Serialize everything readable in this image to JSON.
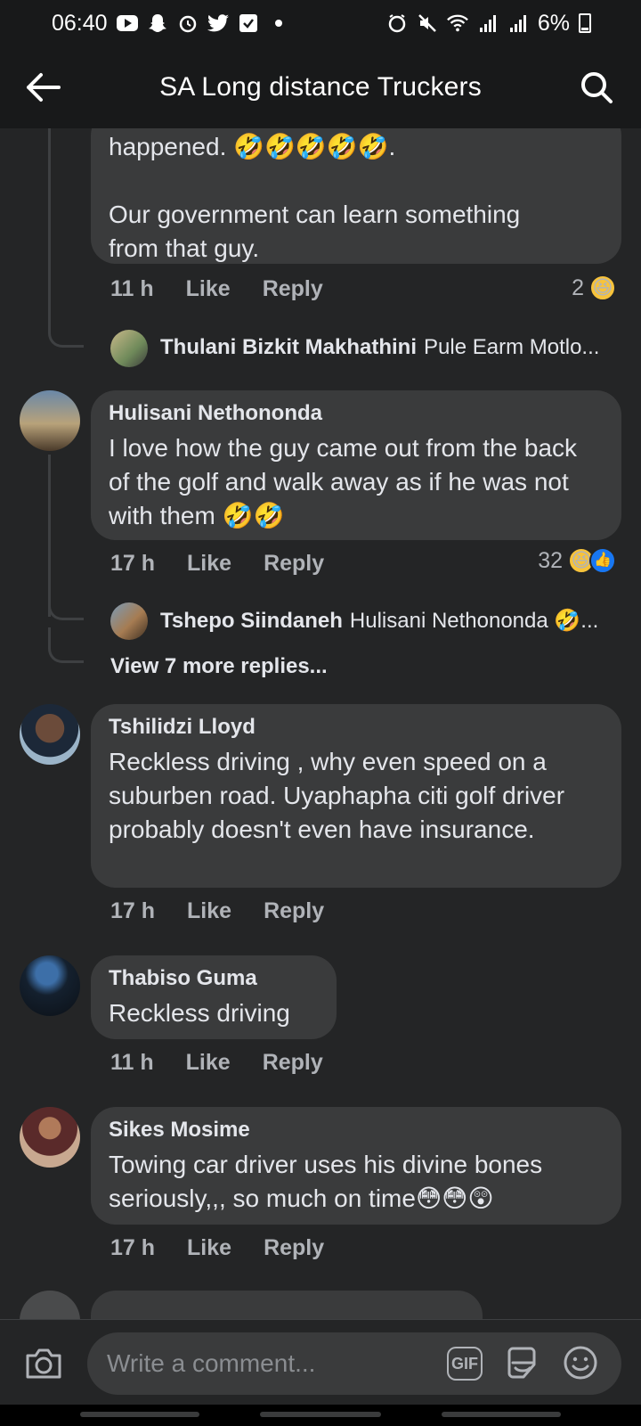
{
  "status_bar": {
    "time": "06:40",
    "battery": "6%",
    "left_icons": [
      "youtube-icon",
      "snapchat-icon",
      "alarm-app-icon",
      "twitter-icon",
      "download-icon"
    ],
    "right_icons": [
      "alarm-icon",
      "mute-icon",
      "wifi-icon",
      "signal-icon",
      "signal-icon-2",
      "battery-icon"
    ]
  },
  "header": {
    "title": "SA Long distance Truckers"
  },
  "comments": [
    {
      "text_line1": "happened. 🤣🤣🤣🤣🤣.",
      "text_line2": "Our government can learn something",
      "text_line3": "from that guy.",
      "time": "11 h",
      "like": "Like",
      "reply": "Reply",
      "reaction_count": "2",
      "reply_preview": {
        "name": "Thulani Bizkit Makhathini",
        "text": "Pule Earm Motlo..."
      }
    },
    {
      "author": "Hulisani Nethononda",
      "text": "I love how the guy came out from the back of the golf and walk away as if he was not with them 🤣🤣",
      "time": "17 h",
      "like": "Like",
      "reply": "Reply",
      "reaction_count": "32",
      "reply_preview": {
        "name": "Tshepo Siindaneh",
        "text": "Hulisani Nethononda 🤣..."
      },
      "view_more": "View 7 more replies..."
    },
    {
      "author": "Tshilidzi Lloyd",
      "text": "Reckless driving , why even speed on a suburben road. Uyaphapha citi golf driver probably doesn't even have insurance.",
      "time": "17 h",
      "like": "Like",
      "reply": "Reply"
    },
    {
      "author": "Thabiso Guma",
      "text": "Reckless driving",
      "time": "11 h",
      "like": "Like",
      "reply": "Reply"
    },
    {
      "author": "Sikes Mosime",
      "text": "Towing car driver uses his divine bones seriously,,, so much on time😳😳😲",
      "time": "17 h",
      "like": "Like",
      "reply": "Reply"
    }
  ],
  "composer": {
    "placeholder": "Write a comment...",
    "gif_label": "GIF"
  },
  "colors": {
    "background": "#242526",
    "bubble": "#3a3b3c",
    "text": "#e4e6eb",
    "muted": "#b0b3b8",
    "like_blue": "#1877f2",
    "haha_yellow": "#f7c33b"
  }
}
